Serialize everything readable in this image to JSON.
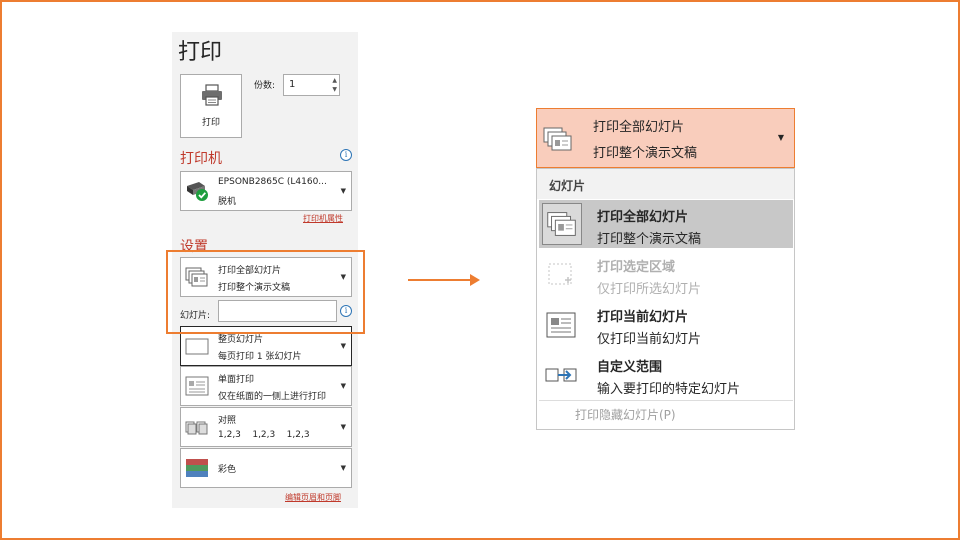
{
  "print_panel": {
    "title": "打印",
    "print_button_label": "打印",
    "copies_label": "份数:",
    "copies_value": "1",
    "printer_section": "打印机",
    "printer": {
      "name": "EPSONB2865C (L4160...",
      "status": "脱机"
    },
    "printer_properties_link": "打印机属性",
    "settings_section": "设置",
    "settings": [
      {
        "line1": "打印全部幻灯片",
        "line2": "打印整个演示文稿",
        "icon": "all-slides-icon"
      },
      {
        "line1": "整页幻灯片",
        "line2": "每页打印 1 张幻灯片",
        "icon": "full-page-icon"
      },
      {
        "line1": "单面打印",
        "line2": "仅在纸面的一侧上进行打印",
        "icon": "single-side-icon"
      },
      {
        "line1": "对照",
        "line2": "1,2,3    1,2,3    1,2,3",
        "icon": "collate-icon"
      },
      {
        "line1": "彩色",
        "line2": "",
        "icon": "color-icon"
      }
    ],
    "slides_label": "幻灯片:",
    "slides_value": "",
    "edit_header_footer_link": "编辑页眉和页脚"
  },
  "dropdown": {
    "selected": {
      "line1": "打印全部幻灯片",
      "line2": "打印整个演示文稿"
    },
    "group_header": "幻灯片",
    "items": [
      {
        "title": "打印全部幻灯片",
        "subtitle": "打印整个演示文稿",
        "selected": true,
        "disabled": false,
        "icon": "all-slides-icon"
      },
      {
        "title": "打印选定区域",
        "subtitle": "仅打印所选幻灯片",
        "selected": false,
        "disabled": true,
        "icon": "selection-icon"
      },
      {
        "title": "打印当前幻灯片",
        "subtitle": "仅打印当前幻灯片",
        "selected": false,
        "disabled": false,
        "icon": "current-slide-icon"
      },
      {
        "title": "自定义范围",
        "subtitle": "输入要打印的特定幻灯片",
        "selected": false,
        "disabled": false,
        "icon": "custom-range-icon"
      }
    ],
    "hidden_slides_option": "打印隐藏幻灯片(P)"
  },
  "colors": {
    "accent": "#ED7D31",
    "section_title": "#C0392B",
    "info": "#2E75B6"
  }
}
